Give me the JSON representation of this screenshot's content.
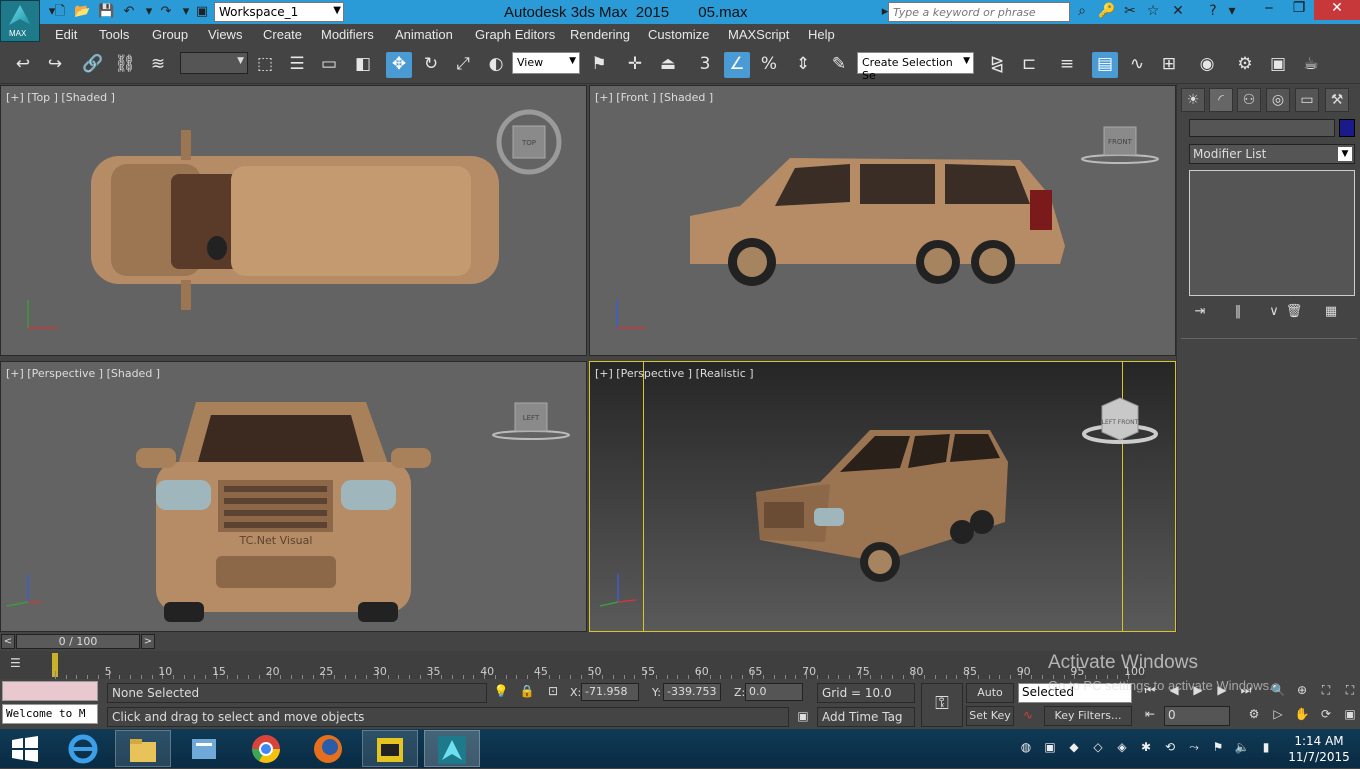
{
  "app": {
    "title": "Autodesk 3ds Max  2015       05.max",
    "logo_text": "MAX",
    "workspace": "Workspace_1",
    "search_placeholder": "Type a keyword or phrase"
  },
  "menu": [
    "Edit",
    "Tools",
    "Group",
    "Views",
    "Create",
    "Modifiers",
    "Animation",
    "Graph Editors",
    "Rendering",
    "Customize",
    "MAXScript",
    "Help"
  ],
  "toolbar": {
    "view_dropdown": "View",
    "selection_set": "Create Selection Se",
    "snap_value": "3"
  },
  "viewports": {
    "top": {
      "label": "[+] [Top ] [Shaded ]",
      "cube": "TOP"
    },
    "front": {
      "label": "[+] [Front ] [Shaded ]",
      "cube": "FRONT"
    },
    "persp1": {
      "label": "[+] [Perspective ] [Shaded ]",
      "cube": "LEFT"
    },
    "persp2": {
      "label": "[+] [Perspective ] [Realistic ]",
      "cube": "LEFT FRONT"
    },
    "plate_text": "TC.Net Visual"
  },
  "command_panel": {
    "modifier_list": "Modifier List"
  },
  "timeline": {
    "frame": "0 / 100",
    "prev": "<",
    "next": ">",
    "labels": [
      "5",
      "10",
      "15",
      "20",
      "25",
      "30",
      "35",
      "40",
      "45",
      "50",
      "55",
      "60",
      "65",
      "70",
      "75",
      "80",
      "85",
      "90",
      "95",
      "100"
    ]
  },
  "status": {
    "selection": "None Selected",
    "prompt": "Click and drag to select and move objects",
    "maxscript": "Welcome to M",
    "x_label": "X:",
    "x_value": "-71.958",
    "y_label": "Y:",
    "y_value": "-339.753",
    "z_label": "Z:",
    "z_value": "0.0",
    "grid": "Grid = 10.0",
    "add_time_tag": "Add Time Tag",
    "auto_key": "Auto Key",
    "set_key": "Set Key",
    "key_mode": "Selected",
    "key_filters": "Key Filters...",
    "frame_value": "0"
  },
  "watermark": {
    "title": "Activate Windows",
    "subtitle": "Go to PC settings to activate Windows."
  },
  "taskbar": {
    "time": "1:14 AM",
    "date": "11/7/2015"
  }
}
